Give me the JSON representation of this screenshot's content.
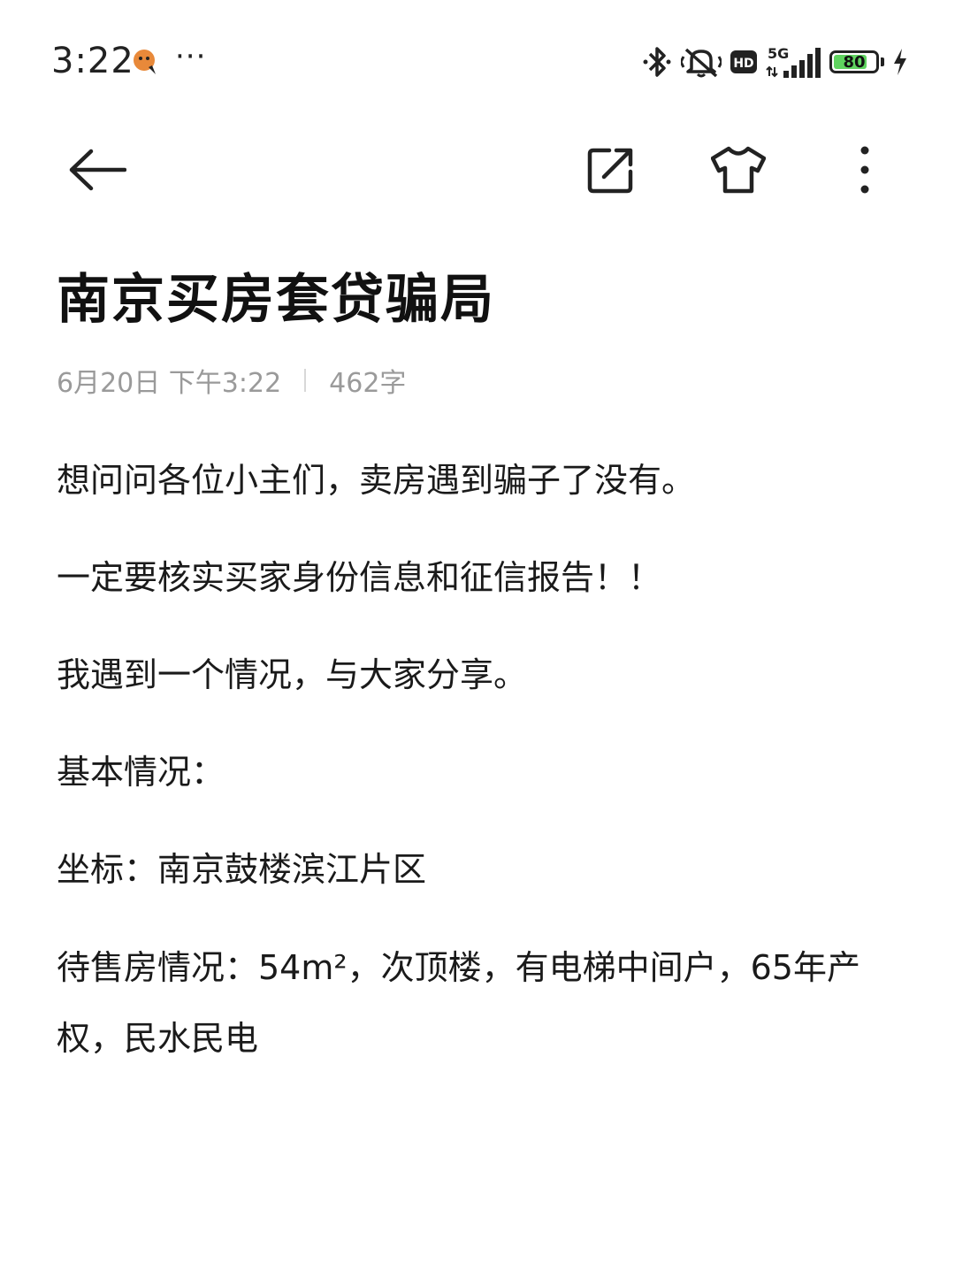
{
  "status_bar": {
    "time": "3:22",
    "more": "···",
    "network": "5G",
    "hd": "HD",
    "battery_level": 80,
    "battery_text": "80",
    "icons": [
      "notification-bubble-icon",
      "bluetooth-icon",
      "mute-icon",
      "hd-icon",
      "5g-signal-icon",
      "battery-icon",
      "charging-icon"
    ],
    "colors": {
      "battery_fill": "#5fd35f"
    }
  },
  "nav": {
    "icons": [
      "back-arrow-icon",
      "share-icon",
      "tshirt-skin-icon",
      "more-vertical-icon"
    ]
  },
  "note": {
    "title": "南京买房套贷骗局",
    "date": "6月20日 下午3:22",
    "word_count": "462字",
    "paragraphs": [
      "想问问各位小主们，卖房遇到骗子了没有。",
      "一定要核实买家身份信息和征信报告！！",
      "我遇到一个情况，与大家分享。",
      "基本情况：",
      "坐标：南京鼓楼滨江片区",
      "待售房情况：54m²，次顶楼，有电梯中间户，65年产权，民水民电"
    ]
  }
}
